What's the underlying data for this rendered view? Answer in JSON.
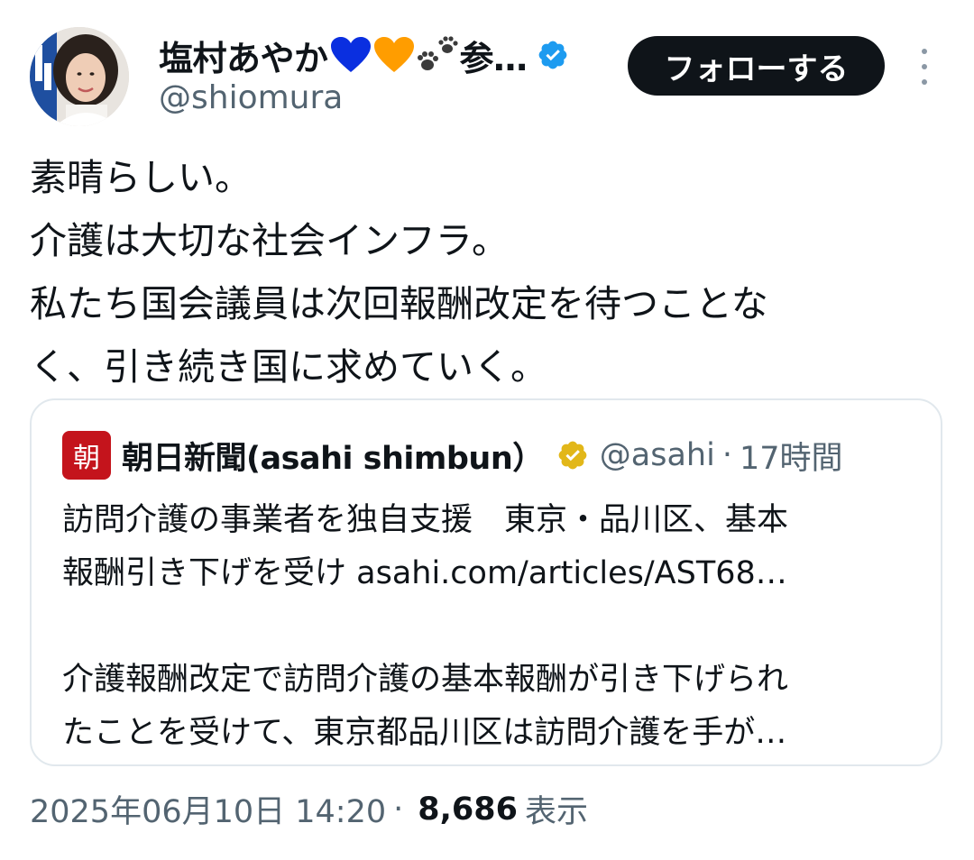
{
  "author": {
    "display_name": "塩村あやか💙🧡🐾参…",
    "name_text": "塩村あやか",
    "name_suffix": "参…",
    "handle": "@shiomura",
    "follow_label": "フォローする"
  },
  "tweet": {
    "lines": [
      "素晴らしい。",
      "介護は大切な社会インフラ。",
      "私たち国会議員は次回報酬改定を待つことな",
      "く、引き続き国に求めていく。"
    ]
  },
  "quote": {
    "logo_char": "朝",
    "name": "朝日新聞(asahi shimbun）",
    "handle": "@asahi",
    "separator": "·",
    "time": "17時間",
    "headline_line1": "訪問介護の事業者を独自支援　東京・品川区、基本",
    "headline_line2_text": "報酬引き下げを受け ",
    "link": "asahi.com/articles/AST68…",
    "body_line1": "介護報酬改定で訪問介護の基本報酬が引き下げられ",
    "body_line2": "たことを受けて、東京都品川区は訪問介護を手が…"
  },
  "meta": {
    "timestamp": "2025年06月10日 14:20",
    "separator": "·",
    "views_count": "8,686",
    "views_label": "表示"
  },
  "colors": {
    "verified_blue": "#1d9bf0",
    "gold_badge": "#e2b719",
    "asahi_red": "#c4141c",
    "follow_button": "#0f1419"
  },
  "icons": {
    "verified": "verified-blue-badge-icon",
    "gold": "verified-gold-badge-icon",
    "more": "more-vertical-icon",
    "blue_heart": "blue-heart-emoji",
    "orange_heart": "orange-heart-emoji",
    "paws": "paw-prints-emoji"
  }
}
